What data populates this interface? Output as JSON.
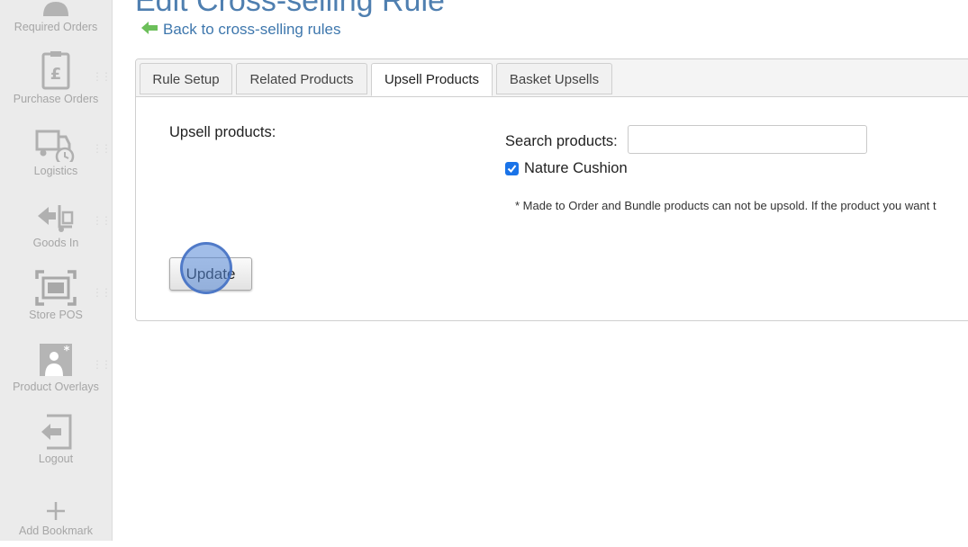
{
  "sidebar": {
    "items": [
      {
        "label": "Required Orders",
        "icon": "required-orders-icon"
      },
      {
        "label": "Purchase Orders",
        "icon": "purchase-orders-icon"
      },
      {
        "label": "Logistics",
        "icon": "truck-clock-icon"
      },
      {
        "label": "Goods In",
        "icon": "goods-in-icon"
      },
      {
        "label": "Store POS",
        "icon": "store-pos-icon"
      },
      {
        "label": "Product Overlays",
        "icon": "product-overlays-icon"
      },
      {
        "label": "Logout",
        "icon": "logout-icon"
      },
      {
        "label": "Add Bookmark",
        "icon": "plus-icon"
      }
    ]
  },
  "header": {
    "title": "Edit Cross-selling Rule",
    "back_link": "Back to cross-selling rules"
  },
  "tabs": [
    {
      "label": "Rule Setup",
      "active": false
    },
    {
      "label": "Related Products",
      "active": false
    },
    {
      "label": "Upsell Products",
      "active": true
    },
    {
      "label": "Basket Upsells",
      "active": false
    }
  ],
  "form": {
    "upsell_label": "Upsell products:",
    "search_label": "Search products:",
    "search_value": "",
    "product_checkbox": {
      "label": "Nature Cushion",
      "checked": true
    },
    "note": "* Made to Order and Bundle products can not be upsold. If the product you want t",
    "update_label": "Update"
  },
  "colors": {
    "title": "#4f7fb0",
    "link": "#3e77ad",
    "back_arrow": "#6cbf5a",
    "sidebar_bg": "#ebebeb",
    "checkbox": "#1a73e8",
    "click_indicator": "#5486d6"
  }
}
